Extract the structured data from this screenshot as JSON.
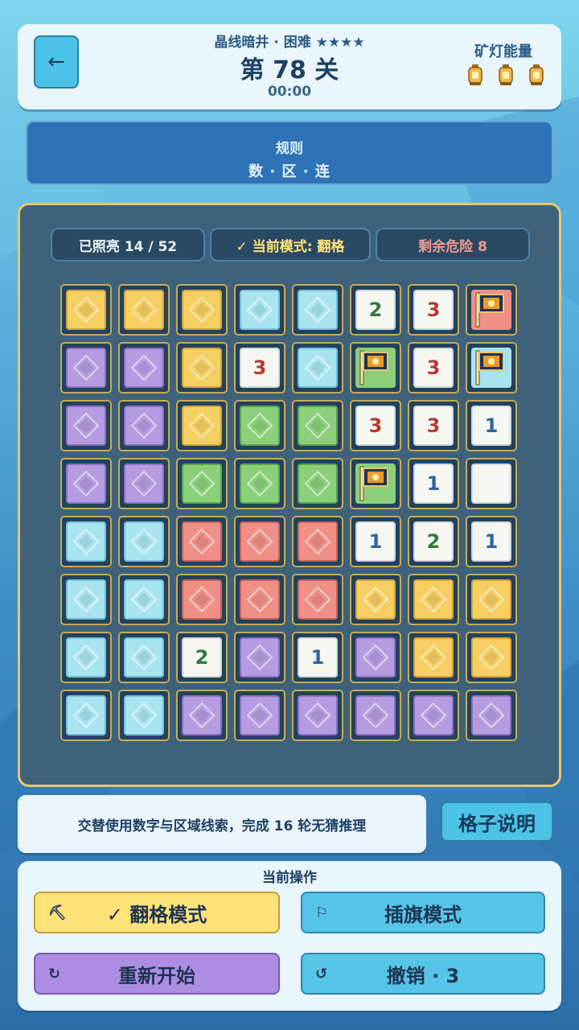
{
  "header": {
    "subtitle": "晶线暗井 · 困难 ★★★★",
    "level": "第 78 关",
    "timer": "00:00",
    "lamp_label": "矿灯能量",
    "lamp_count": 3,
    "back_icon": "back-arrow-icon"
  },
  "rules": {
    "title": "规则",
    "items": "数 · 区 · 连"
  },
  "stats": {
    "lit": "已照亮 14 / 52",
    "mode": "✓ 当前模式: 翻格",
    "danger": "剩余危险 8"
  },
  "grid": [
    [
      "y",
      "y",
      "y",
      "b",
      "b",
      "n2g",
      "n3r",
      "flag-red"
    ],
    [
      "p",
      "p",
      "y",
      "n3r",
      "b",
      "flag-green",
      "n3r",
      "flag-blue"
    ],
    [
      "p",
      "p",
      "y",
      "g",
      "g",
      "n3r",
      "n3r",
      "n1b"
    ],
    [
      "p",
      "p",
      "g",
      "g",
      "g",
      "flag-green",
      "n1b",
      "n"
    ],
    [
      "b",
      "b",
      "r",
      "r",
      "r",
      "n1b",
      "n2g",
      "n1b"
    ],
    [
      "b",
      "b",
      "r",
      "r",
      "r",
      "y",
      "y",
      "y"
    ],
    [
      "b",
      "b",
      "n2g",
      "p",
      "n1b",
      "p",
      "y",
      "y"
    ],
    [
      "b",
      "b",
      "p",
      "p",
      "p",
      "p",
      "p",
      "p"
    ]
  ],
  "hint": "交替使用数字与区域线索，完成 16 轮无猜推理",
  "explain_button": "格子说明",
  "ops": {
    "label": "当前操作",
    "flip": "✓ 翻格模式",
    "flag": "插旗模式",
    "restart": "重新开始",
    "undo": "撤销 · 3"
  },
  "colors": {
    "yellow": "#f6cf62",
    "blue": "#a8e3f0",
    "purple": "#b69be0",
    "green": "#8ccf7a",
    "red": "#ef8f86",
    "board_border": "#e8c56d"
  }
}
